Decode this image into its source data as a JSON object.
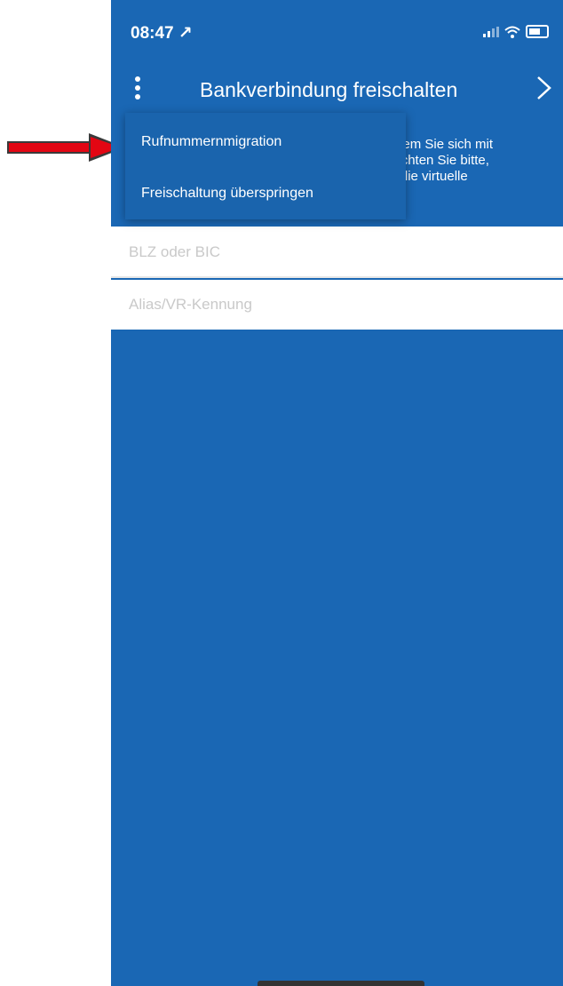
{
  "status_bar": {
    "time": "08:47 ↗"
  },
  "nav": {
    "title": "Bankverbindung freischalten"
  },
  "intro": {
    "text_fragment": ", indem Sie sich mit\nBeachten Sie bitte,\nnur die virtuelle"
  },
  "dropdown": {
    "items": [
      {
        "label": "Rufnummernmigration"
      },
      {
        "label": "Freischaltung überspringen"
      }
    ]
  },
  "form": {
    "blz_placeholder": "BLZ oder BIC",
    "alias_placeholder": "Alias/VR-Kennung"
  },
  "colors": {
    "primary": "#1a67b4",
    "arrow": "#e30613"
  },
  "icons": {
    "menu": "more-vertical-icon",
    "next": "chevron-right-icon",
    "annotation": "red-arrow-icon"
  }
}
